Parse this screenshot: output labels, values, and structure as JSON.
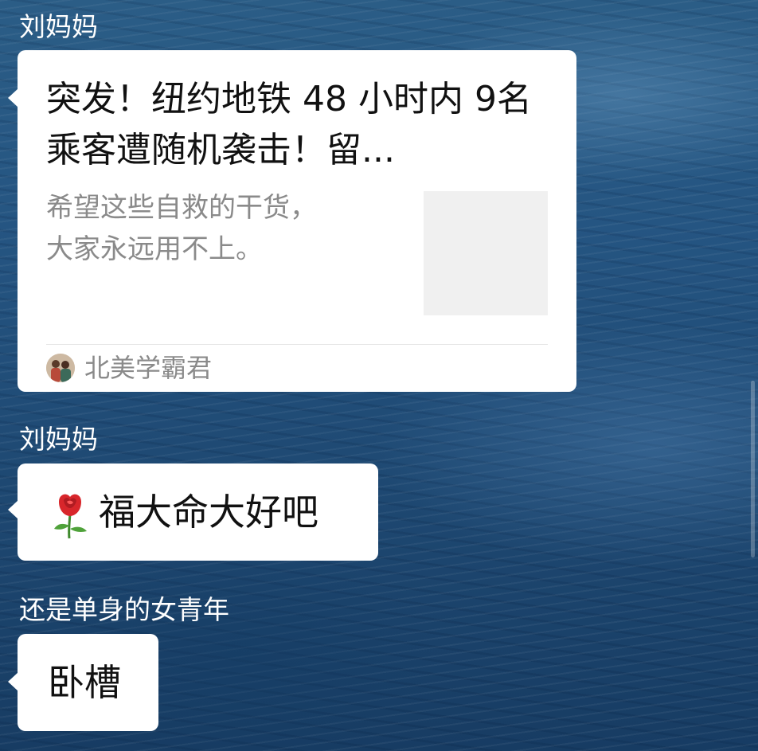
{
  "messages": [
    {
      "sender": "刘妈妈",
      "type": "article",
      "title": "突发！纽约地铁 48 小时内 9名乘客遭随机袭击！留...",
      "description_lines": [
        "希望这些自救的干货，",
        "大家永远用不上。"
      ],
      "source": "北美学霸君",
      "source_icon": "source-avatar-icon"
    },
    {
      "sender": "刘妈妈",
      "type": "text",
      "emoji": "rose-emoji",
      "text": "福大命大好吧"
    },
    {
      "sender": "还是单身的女青年",
      "type": "text",
      "text": "卧槽"
    }
  ],
  "colors": {
    "bubble": "#ffffff",
    "sender_text": "#ffffff",
    "secondary_text": "#8a8a8a",
    "thumbnail_placeholder": "#f0f0f0",
    "background": "#255582"
  }
}
